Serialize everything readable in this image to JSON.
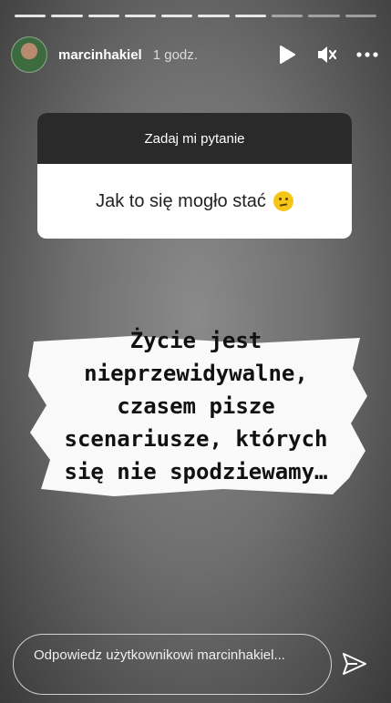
{
  "story": {
    "segments_total": 10,
    "segments_viewed": 7
  },
  "header": {
    "username": "marcinhakiel",
    "time": "1 godz.",
    "icons": [
      "play-icon",
      "mute-icon",
      "more-icon"
    ]
  },
  "question_sticker": {
    "title": "Zadaj mi pytanie",
    "answer": "Jak to się mogło stać"
  },
  "quote": {
    "lines": [
      "Życie jest",
      "nieprzewidywalne,",
      "czasem pisze",
      "scenariusze, których",
      "się nie spodziewamy…"
    ]
  },
  "reply": {
    "placeholder": "Odpowiedz użytkownikowi marcinhakiel..."
  }
}
